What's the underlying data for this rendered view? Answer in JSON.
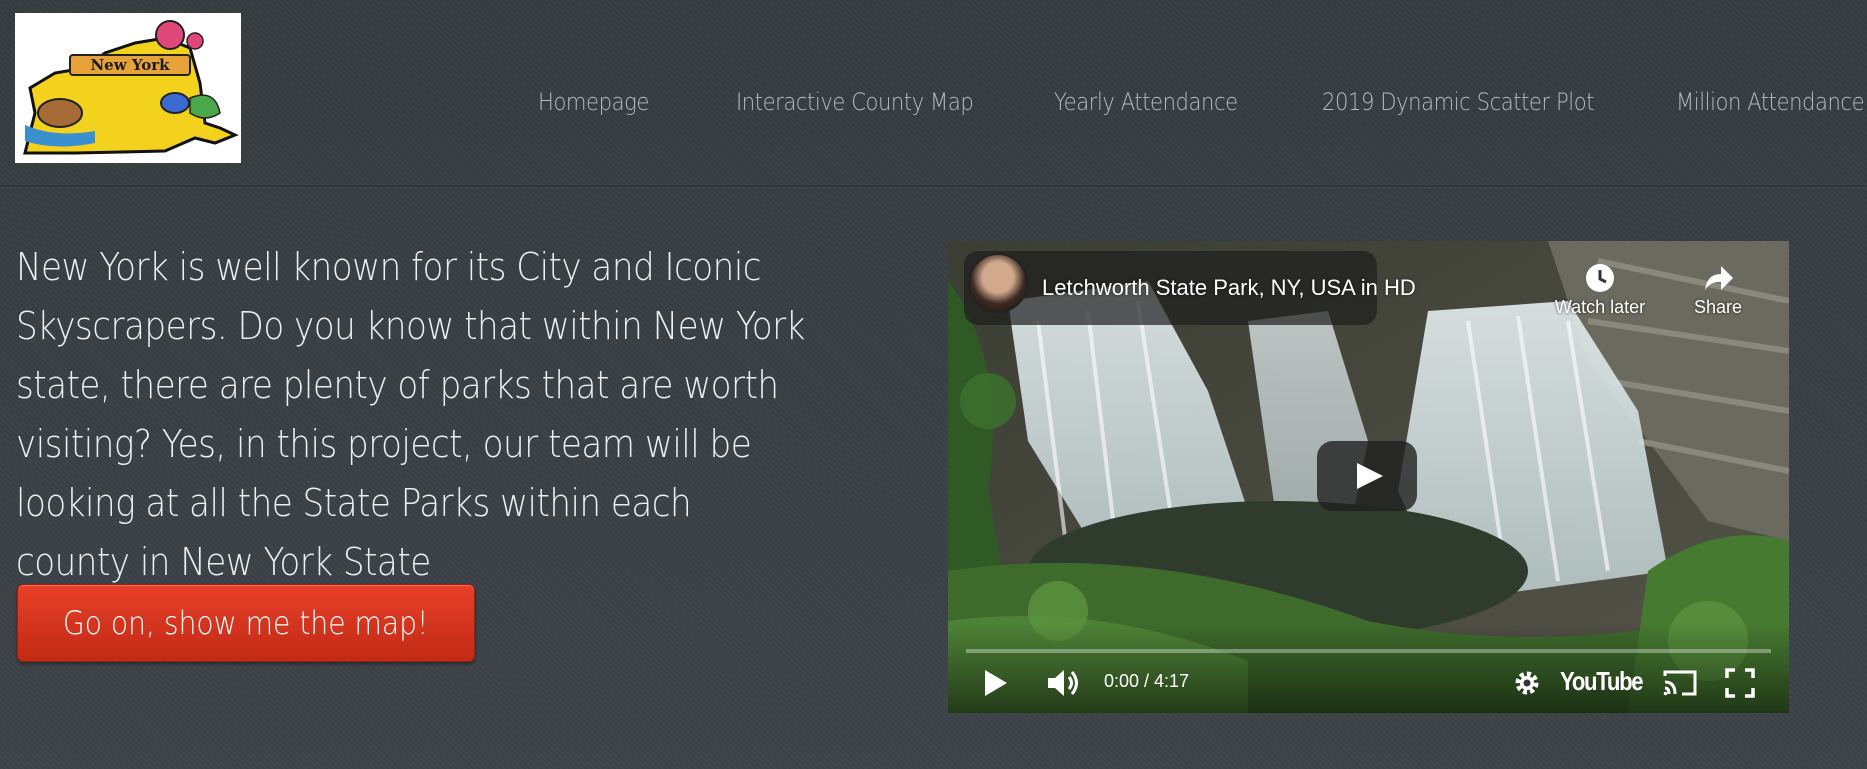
{
  "logo": {
    "text": "New York",
    "alt_icon": "new-york-state-logo"
  },
  "nav": {
    "items": [
      {
        "label": "Homepage"
      },
      {
        "label": "Interactive County Map"
      },
      {
        "label": "Yearly Attendance"
      },
      {
        "label": "2019 Dynamic Scatter Plot"
      },
      {
        "label": "Million Attendance"
      }
    ]
  },
  "intro": {
    "text": "New York is well known for its City and Iconic Skyscrapers. Do you know that within New York state, there are plenty of parks that are worth visiting? Yes, in this project, our team will be looking at all the State Parks within each county in New York State"
  },
  "cta": {
    "label": "Go on, show me the map!",
    "color": "#d83520"
  },
  "video": {
    "title": "Letchworth State Park, NY, USA in HD",
    "watch_later": "Watch later",
    "share": "Share",
    "time": "0:00 / 4:17",
    "progress": 0,
    "brand": "YouTube",
    "icons": [
      "play-icon",
      "volume-icon",
      "settings-icon",
      "cast-icon",
      "fullscreen-icon",
      "clock-icon",
      "share-icon"
    ]
  }
}
